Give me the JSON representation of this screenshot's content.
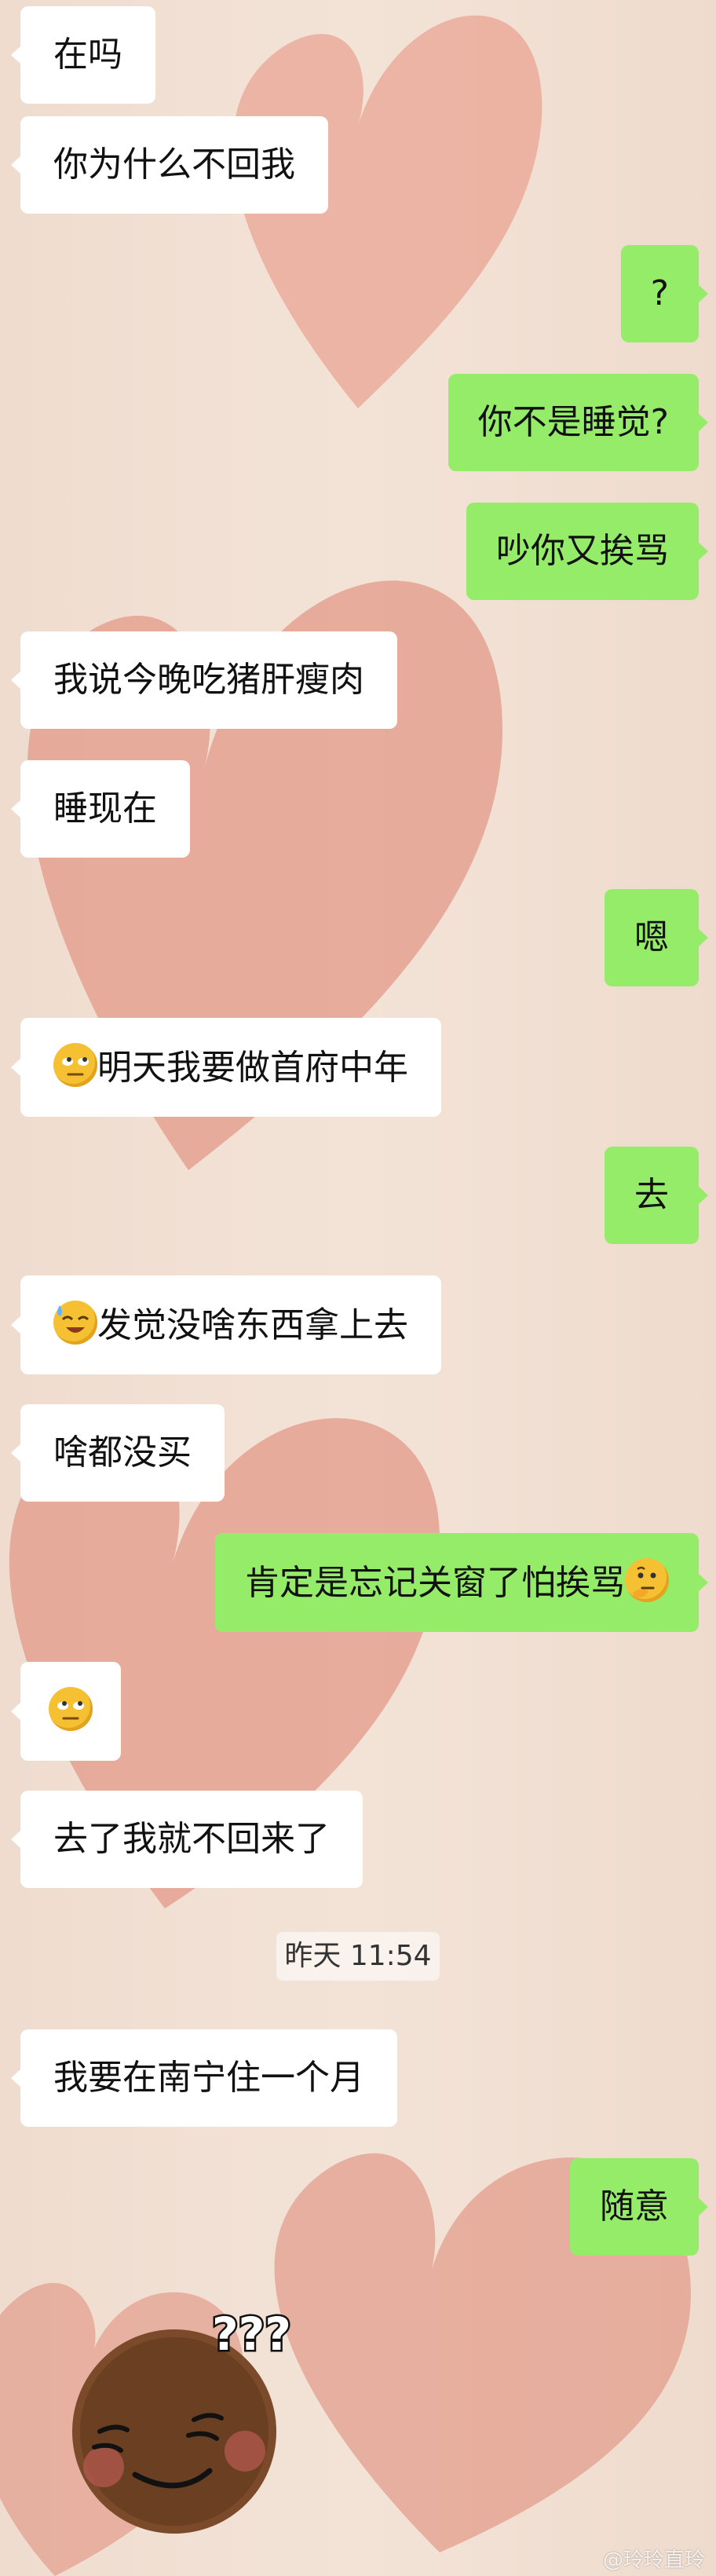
{
  "chat": {
    "messages": [
      {
        "side": "in",
        "text": "在吗"
      },
      {
        "side": "in",
        "text": "你为什么不回我"
      },
      {
        "side": "out",
        "text": "?"
      },
      {
        "side": "out",
        "text": "你不是睡觉?"
      },
      {
        "side": "out",
        "text": "吵你又挨骂"
      },
      {
        "side": "in",
        "text": "我说今晚吃猪肝瘦肉"
      },
      {
        "side": "in",
        "text": "睡现在"
      },
      {
        "side": "out",
        "text": "嗯"
      },
      {
        "side": "in",
        "emoji": "eye-roll-emoji",
        "text": "明天我要做首府中年"
      },
      {
        "side": "out",
        "text": "去"
      },
      {
        "side": "in",
        "emoji": "sweat-smile-emoji",
        "text": "发觉没啥东西拿上去"
      },
      {
        "side": "in",
        "text": "啥都没买"
      },
      {
        "side": "out",
        "text": "肯定是忘记关窗了怕挨骂",
        "emoji_after": "thinking-emoji"
      },
      {
        "side": "in",
        "emoji": "eye-roll-emoji",
        "text": ""
      },
      {
        "side": "in",
        "text": "去了我就不回来了"
      },
      {
        "side": "in",
        "text": "我要在南宁住一个月"
      },
      {
        "side": "out",
        "text": "随意"
      }
    ],
    "timestamp": "昨天 11:54"
  },
  "sticker": {
    "caption": "???",
    "icon": "smiling-face-sticker"
  },
  "watermark": "@玲玲直玲",
  "colors": {
    "incoming_bubble": "#ffffff",
    "outgoing_bubble": "#95ec69",
    "background": "#f1e0d3",
    "heart": "#e3a08f"
  }
}
